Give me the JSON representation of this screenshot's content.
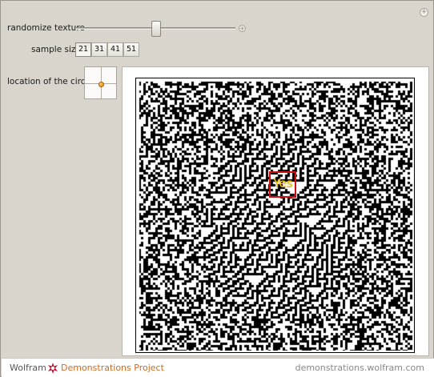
{
  "controls": {
    "randomize_label": "randomize texture",
    "randomize_value": 0.48,
    "sample_size_label": "sample size",
    "sample_sizes": [
      "21",
      "31",
      "41",
      "51"
    ],
    "sample_size_selected": "21",
    "location_label": "location of the circle",
    "location_value": [
      0.45,
      0.55
    ]
  },
  "plot": {
    "result_text": "Yes",
    "colors": {
      "foreground": "#000000",
      "background": "#ffffff",
      "circle": "#cc1010",
      "text": "#ffd000"
    }
  },
  "footer": {
    "brand": "Wolfram",
    "project": "Demonstrations Project",
    "site": "demonstrations.wolfram.com",
    "brand_color": "#d2691e"
  },
  "icons": {
    "corner": "plus-circle-icon",
    "logo": "spikey-icon"
  }
}
